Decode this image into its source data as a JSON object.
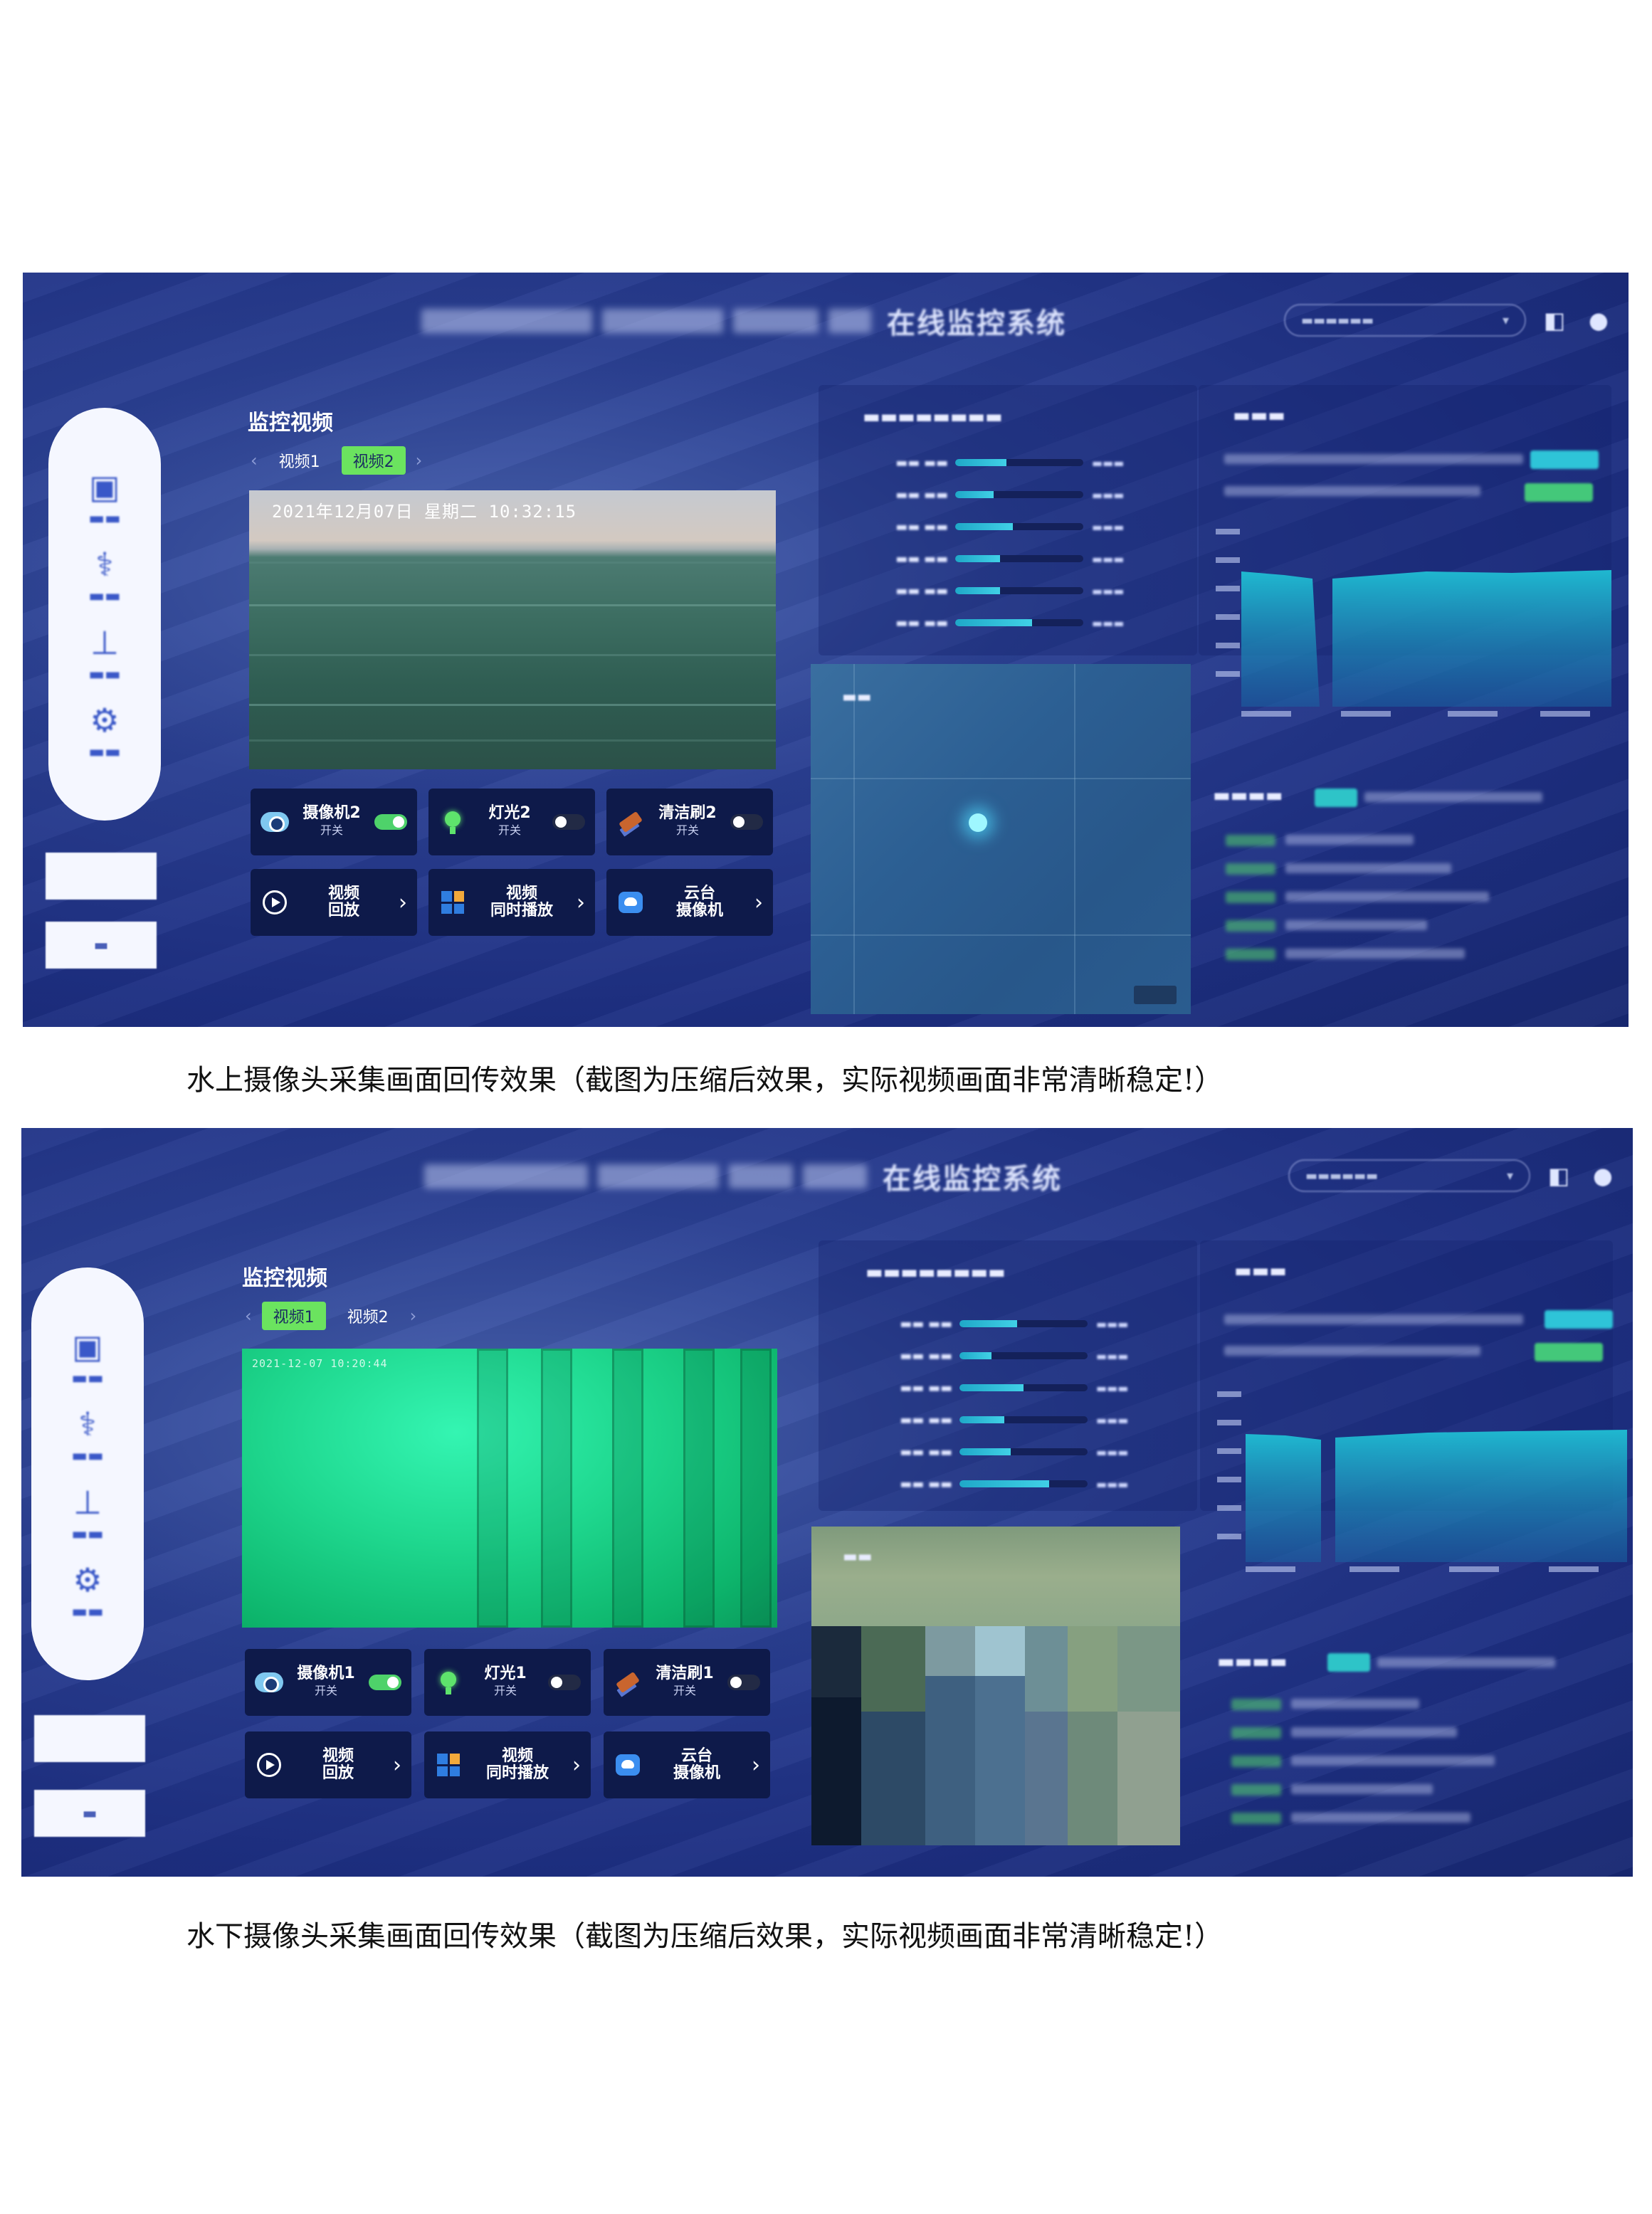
{
  "screenshots": [
    {
      "header_title": "在线监控系统",
      "panel_title": "监控视频",
      "tabs": [
        "视频1",
        "视频2"
      ],
      "active_tab": 1,
      "video_timestamp": "2021年12月07日  星期二  10:32:15",
      "controls": [
        {
          "name": "摄像机2",
          "switch": "开关",
          "on": true
        },
        {
          "name": "灯光2",
          "switch": "开关",
          "on": false
        },
        {
          "name": "清洁刷2",
          "switch": "开关",
          "on": false
        }
      ],
      "actions": [
        {
          "line1": "视频",
          "line2": "回放"
        },
        {
          "line1": "视频",
          "line2": "同时播放"
        },
        {
          "line1": "云台",
          "line2": "摄像机"
        }
      ],
      "sensor_levels": [
        0.4,
        0.3,
        0.45,
        0.35,
        0.35,
        0.6
      ],
      "caption": "水上摄像头采集画面回传效果（截图为压缩后效果，实际视频画面非常清晰稳定!）"
    },
    {
      "header_title": "在线监控系统",
      "panel_title": "监控视频",
      "tabs": [
        "视频1",
        "视频2"
      ],
      "active_tab": 0,
      "video_timestamp": "2021-12-07 10:20:44",
      "controls": [
        {
          "name": "摄像机1",
          "switch": "开关",
          "on": true
        },
        {
          "name": "灯光1",
          "switch": "开关",
          "on": false
        },
        {
          "name": "清洁刷1",
          "switch": "开关",
          "on": false
        }
      ],
      "actions": [
        {
          "line1": "视频",
          "line2": "回放"
        },
        {
          "line1": "视频",
          "line2": "同时播放"
        },
        {
          "line1": "云台",
          "line2": "摄像机"
        }
      ],
      "sensor_levels": [
        0.45,
        0.25,
        0.5,
        0.35,
        0.4,
        0.7
      ],
      "caption": "水下摄像头采集画面回传效果（截图为压缩后效果，实际视频画面非常清晰稳定!）"
    }
  ],
  "colors": {
    "accent_green": "#6be35f",
    "dashboard_bg": "#1d2f82",
    "control_bg": "#0e1a4a",
    "chart_fill": "#1fa8c8"
  }
}
